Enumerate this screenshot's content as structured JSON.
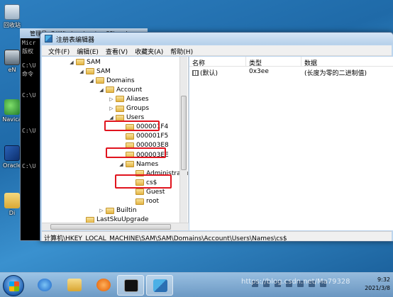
{
  "desktop": {
    "icons": [
      {
        "label": "回收站"
      },
      {
        "label": "Micr"
      },
      {
        "label": "eN"
      },
      {
        "label": "Navica"
      },
      {
        "label": "Oracle"
      },
      {
        "label": "Di"
      }
    ]
  },
  "console": {
    "title": "管理员: C:\\Windows\\system32\\cmd.exe",
    "lines": [
      "Micr",
      "版权",
      "C:\\U",
      "命令",
      "C:\\U",
      "C:\\U",
      "C:\\U"
    ]
  },
  "window": {
    "title": "注册表编辑器",
    "menu": [
      "文件(F)",
      "编辑(E)",
      "查看(V)",
      "收藏夹(A)",
      "帮助(H)"
    ],
    "tree": [
      {
        "label": "SAM",
        "expander": "◢"
      },
      {
        "label": "SAM",
        "expander": "◢"
      },
      {
        "label": "Domains",
        "expander": "◢"
      },
      {
        "label": "Account",
        "expander": "◢"
      },
      {
        "label": "Aliases",
        "expander": "▷"
      },
      {
        "label": "Groups",
        "expander": "▷"
      },
      {
        "label": "Users",
        "expander": "◢"
      },
      {
        "label": "000001F4",
        "expander": ""
      },
      {
        "label": "000001F5",
        "expander": ""
      },
      {
        "label": "000003E8",
        "expander": ""
      },
      {
        "label": "000003EE",
        "expander": ""
      },
      {
        "label": "Names",
        "expander": "◢"
      },
      {
        "label": "Administrator",
        "expander": ""
      },
      {
        "label": "cs$",
        "expander": ""
      },
      {
        "label": "Guest",
        "expander": ""
      },
      {
        "label": "root",
        "expander": ""
      },
      {
        "label": "Builtin",
        "expander": "▷"
      },
      {
        "label": "LastSkuUpgrade",
        "expander": ""
      },
      {
        "label": "RXACT",
        "expander": ""
      }
    ],
    "list": {
      "columns": [
        "名称",
        "类型",
        "数据"
      ],
      "rows": [
        {
          "name": "(默认)",
          "type": "0x3ee",
          "data": "(长度为零的二进制值)"
        }
      ]
    },
    "status": "计算机\\HKEY_LOCAL_MACHINE\\SAM\\SAM\\Domains\\Account\\Users\\Names\\cs$"
  },
  "taskbar": {
    "time": "9:32",
    "date": "2021/3/8",
    "buttons": [
      "start",
      "ie",
      "explorer",
      "media",
      "cmd",
      "regedit"
    ]
  },
  "watermark": "https://blog.csdn.net/Ma79328",
  "colors": {
    "highlight": "#e0141e",
    "selection": "#cce8ff"
  }
}
